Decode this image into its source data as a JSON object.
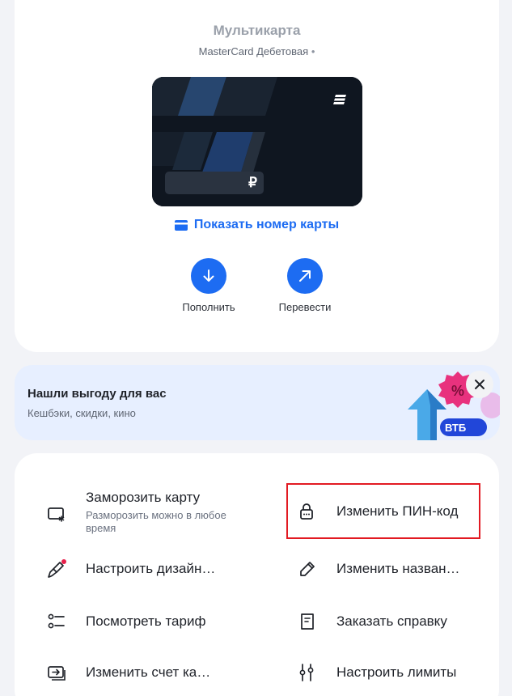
{
  "card": {
    "title": "Мультикарта",
    "subtitle": "MasterCard Дебетовая",
    "subtitle_dot": "•",
    "currency_symbol": "₽",
    "show_number_label": "Показать номер карты"
  },
  "actions": [
    {
      "label": "Пополнить",
      "icon": "arrow-down-icon"
    },
    {
      "label": "Перевести",
      "icon": "arrow-up-right-icon"
    }
  ],
  "promo": {
    "title": "Нашли выгоду для вас",
    "subtitle": "Кешбэки, скидки, кино",
    "badge_text": "ВТБ",
    "percent_symbol": "%"
  },
  "menu": {
    "freeze": {
      "title": "Заморозить карту",
      "subtitle": "Разморозить можно в любое время",
      "icon": "card-freeze-icon"
    },
    "change_pin": {
      "title": "Изменить ПИН-код",
      "icon": "lock-icon"
    },
    "design": {
      "title": "Настроить дизайн…",
      "icon": "brush-icon"
    },
    "rename": {
      "title": "Изменить назван…",
      "icon": "pencil-icon"
    },
    "tariff": {
      "title": "Посмотреть тариф",
      "icon": "list-icon"
    },
    "statement": {
      "title": "Заказать справку",
      "icon": "document-icon"
    },
    "account": {
      "title": "Изменить счет ка…",
      "icon": "account-transfer-icon"
    },
    "limits": {
      "title": "Настроить лимиты",
      "icon": "sliders-icon"
    }
  },
  "colors": {
    "accent": "#1d6cf2",
    "highlight": "#e21a22",
    "notification_dot": "#e8204a"
  }
}
